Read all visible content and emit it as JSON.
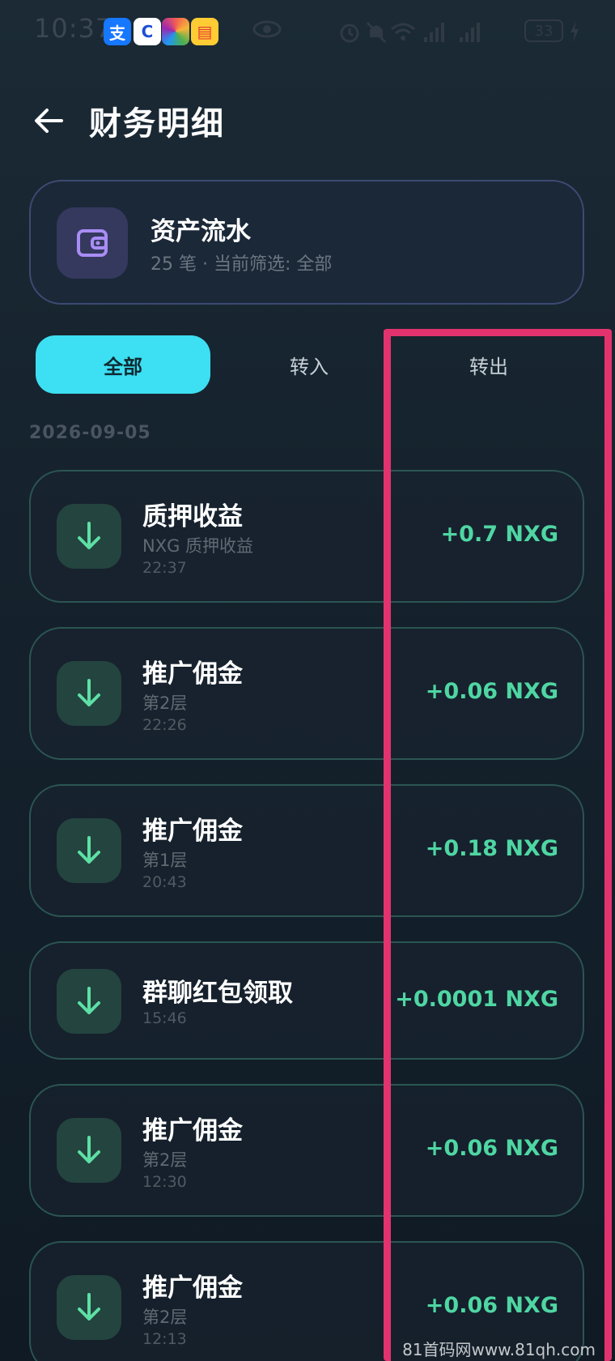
{
  "status_bar": {
    "time": "10:37",
    "battery": "33",
    "app_icons": [
      "alipay-icon",
      "c-app-icon",
      "photos-icon",
      "wallet-app-icon"
    ],
    "alipay_glyph": "支",
    "c_glyph": "C"
  },
  "header": {
    "title": "财务明细",
    "back_icon": "arrow-left-icon"
  },
  "summary": {
    "title": "资产流水",
    "subtitle": "25 笔 · 当前筛选: 全部",
    "icon": "wallet-icon"
  },
  "tabs": [
    {
      "label": "全部",
      "active": true
    },
    {
      "label": "转入",
      "active": false
    },
    {
      "label": "转出",
      "active": false
    }
  ],
  "date_group": "2026-09-05",
  "transactions": [
    {
      "title": "质押收益",
      "subtitle": "NXG 质押收益",
      "time": "22:37",
      "amount": "+0.7 NXG",
      "icon": "arrow-down-icon"
    },
    {
      "title": "推广佣金",
      "subtitle": "第2层",
      "time": "22:26",
      "amount": "+0.06 NXG",
      "icon": "arrow-down-icon"
    },
    {
      "title": "推广佣金",
      "subtitle": "第1层",
      "time": "20:43",
      "amount": "+0.18 NXG",
      "icon": "arrow-down-icon"
    },
    {
      "title": "群聊红包领取",
      "subtitle": "",
      "time": "15:46",
      "amount": "+0.0001 NXG",
      "icon": "arrow-down-icon"
    },
    {
      "title": "推广佣金",
      "subtitle": "第2层",
      "time": "12:30",
      "amount": "+0.06 NXG",
      "icon": "arrow-down-icon"
    },
    {
      "title": "推广佣金",
      "subtitle": "第2层",
      "time": "12:13",
      "amount": "+0.06 NXG",
      "icon": "arrow-down-icon"
    }
  ],
  "colors": {
    "accent": "#3ddff2",
    "income": "#4fd6a3",
    "highlight": "#e2336e"
  },
  "watermark": "81首码网www.81qh.com"
}
